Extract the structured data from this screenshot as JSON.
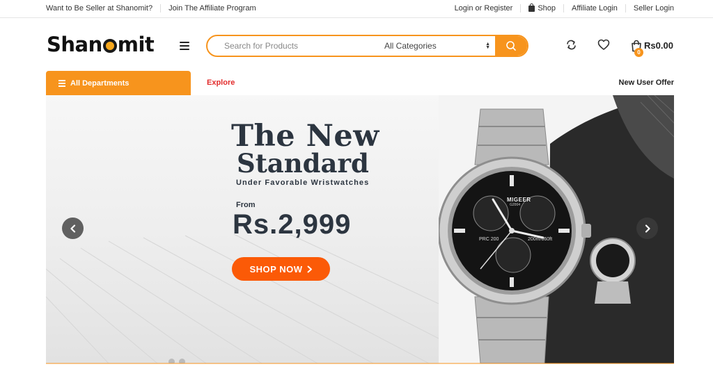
{
  "topbar": {
    "seller_link": "Want to Be Seller at Shanomit?",
    "affiliate_program_link": "Join The Affiliate Program",
    "login_register": "Login or Register",
    "shop": "Shop",
    "affiliate_login": "Affiliate Login",
    "seller_login": "Seller Login"
  },
  "header": {
    "logo_pre": "Shan",
    "logo_post": "mit",
    "search_placeholder": "Search for Products",
    "category_selected": "All Categories",
    "cart_total": "Rs0.00",
    "cart_count": "0"
  },
  "nav": {
    "departments": "All Departments",
    "explore": "Explore",
    "new_user_offer": "New User Offer"
  },
  "banner": {
    "headline_1": "The New",
    "headline_2": "Standard",
    "subline": "Under Favorable Wristwatches",
    "from_label": "From",
    "price": "Rs.2,999",
    "cta": "SHOP NOW",
    "watch_brand": "MIGEER",
    "watch_model": "G2004",
    "watch_prc": "PRC 200",
    "watch_depth": "200m/660ft"
  },
  "colors": {
    "accent": "#f7941d",
    "cta": "#fb5a07",
    "explore": "#e22d2d",
    "text_dark": "#2c3540"
  }
}
